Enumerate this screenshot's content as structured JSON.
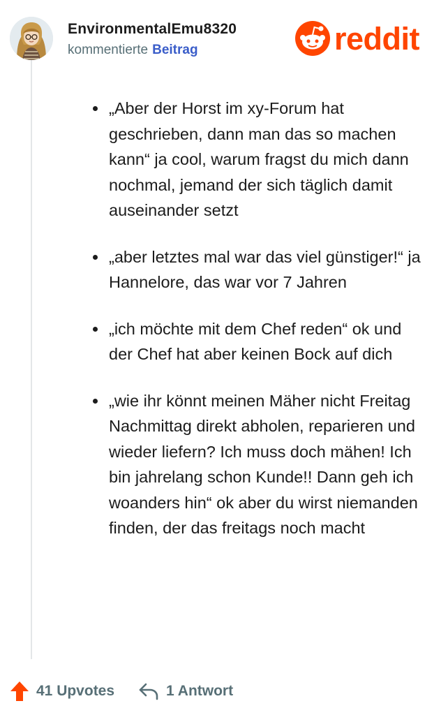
{
  "comment": {
    "username": "EnvironmentalEmu8320",
    "action": "kommentierte",
    "target": "Beitrag",
    "bullets": [
      "„Aber der Horst im xy-Forum hat geschrieben, dann man das so machen kann“ ja cool, warum fragst du mich dann nochmal, jemand der sich täglich damit auseinander setzt",
      "„aber letztes mal war das viel günstiger!“ ja Hannelore, das war vor 7 Jahren",
      "„ich möchte mit dem Chef reden“ ok und der Chef hat aber keinen Bock auf dich",
      "„wie ihr könnt meinen Mäher nicht Freitag Nachmittag direkt abholen, reparieren und wieder liefern? Ich muss doch mähen! Ich bin jahrelang schon Kunde!! Dann geh ich woanders hin“ ok aber du wirst niemanden finden, der das freitags noch macht"
    ]
  },
  "brand": {
    "name": "reddit",
    "color": "#ff4500",
    "icon": "reddit-snoo-icon"
  },
  "footer": {
    "upvotes": "41 Upvotes",
    "upvote_icon": "upvote-arrow-icon",
    "upvote_color": "#ff4500",
    "replies": "1 Antwort",
    "reply_icon": "reply-icon"
  }
}
